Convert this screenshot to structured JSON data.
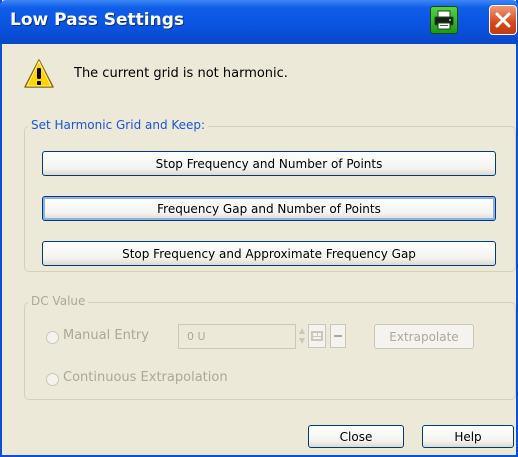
{
  "window": {
    "title": "Low Pass Settings"
  },
  "titlebar": {
    "print_icon": "printer-icon",
    "close_icon": "close-icon"
  },
  "warning": {
    "icon": "warning-icon",
    "text": "The current grid is not harmonic."
  },
  "harmonic_group": {
    "label": "Set Harmonic Grid and Keep:",
    "buttons": [
      "Stop Frequency and Number of Points",
      "Frequency Gap and Number of Points",
      "Stop Frequency and Approximate Frequency Gap"
    ]
  },
  "dc_group": {
    "label": "DC Value",
    "manual_entry_label": "Manual Entry",
    "value": "0 U",
    "extrapolate_label": "Extrapolate",
    "continuous_label": "Continuous Extrapolation"
  },
  "footer": {
    "close_label": "Close",
    "help_label": "Help"
  },
  "colors": {
    "titlebar": "#0a55e2",
    "dialog_bg": "#ece9d8",
    "group_label": "#1b54d9",
    "button_border": "#003c74",
    "disabled_text": "#aca899"
  }
}
